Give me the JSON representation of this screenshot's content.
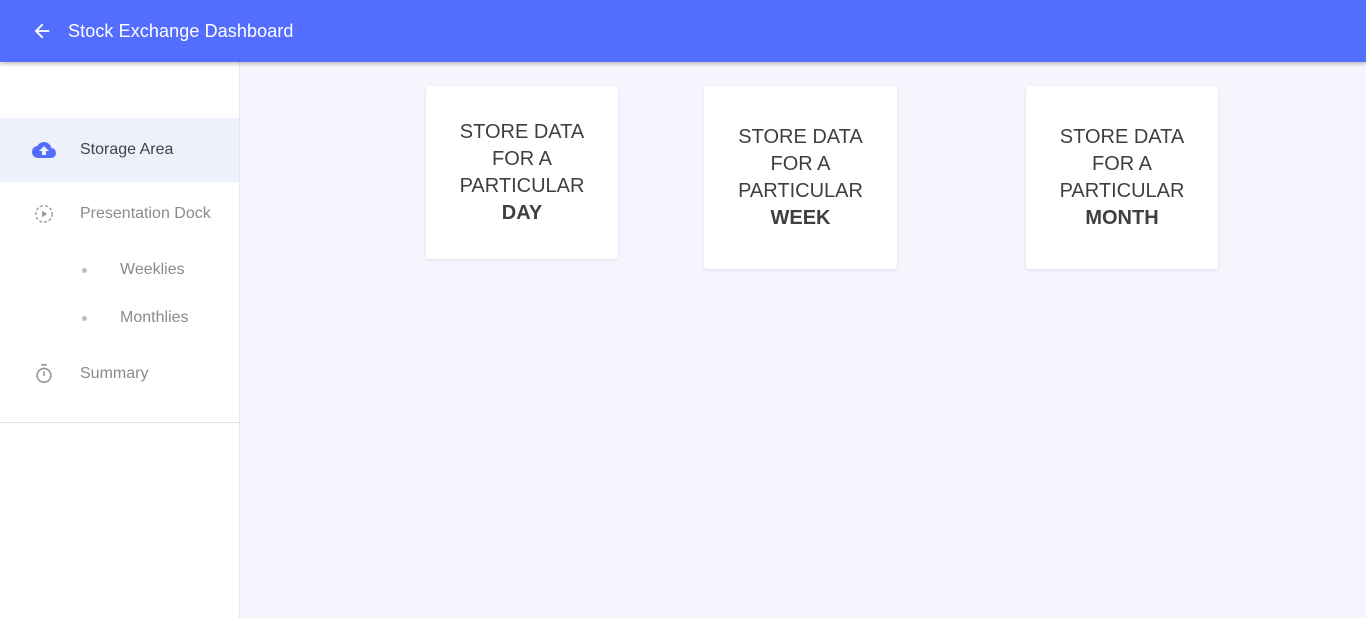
{
  "app": {
    "title": "Stock Exchange Dashboard",
    "accent_color": "#536dfe",
    "back_icon": "arrow-left-icon"
  },
  "sidebar": {
    "items": [
      {
        "label": "Storage Area",
        "icon": "cloud-upload-icon",
        "active": true
      },
      {
        "label": "Presentation Dock",
        "icon": "play-circle-icon",
        "active": false
      },
      {
        "label": "Summary",
        "icon": "timer-icon",
        "active": false
      }
    ],
    "subitems": [
      {
        "label": "Weeklies"
      },
      {
        "label": "Monthlies"
      }
    ]
  },
  "cards": [
    {
      "line1": "STORE DATA",
      "line2": "FOR A",
      "line3": "PARTICULAR",
      "period": "DAY"
    },
    {
      "line1": "STORE DATA",
      "line2": "FOR A",
      "line3": "PARTICULAR",
      "period": "WEEK"
    },
    {
      "line1": "STORE DATA",
      "line2": "FOR A",
      "line3": "PARTICULAR",
      "period": "MONTH"
    }
  ]
}
